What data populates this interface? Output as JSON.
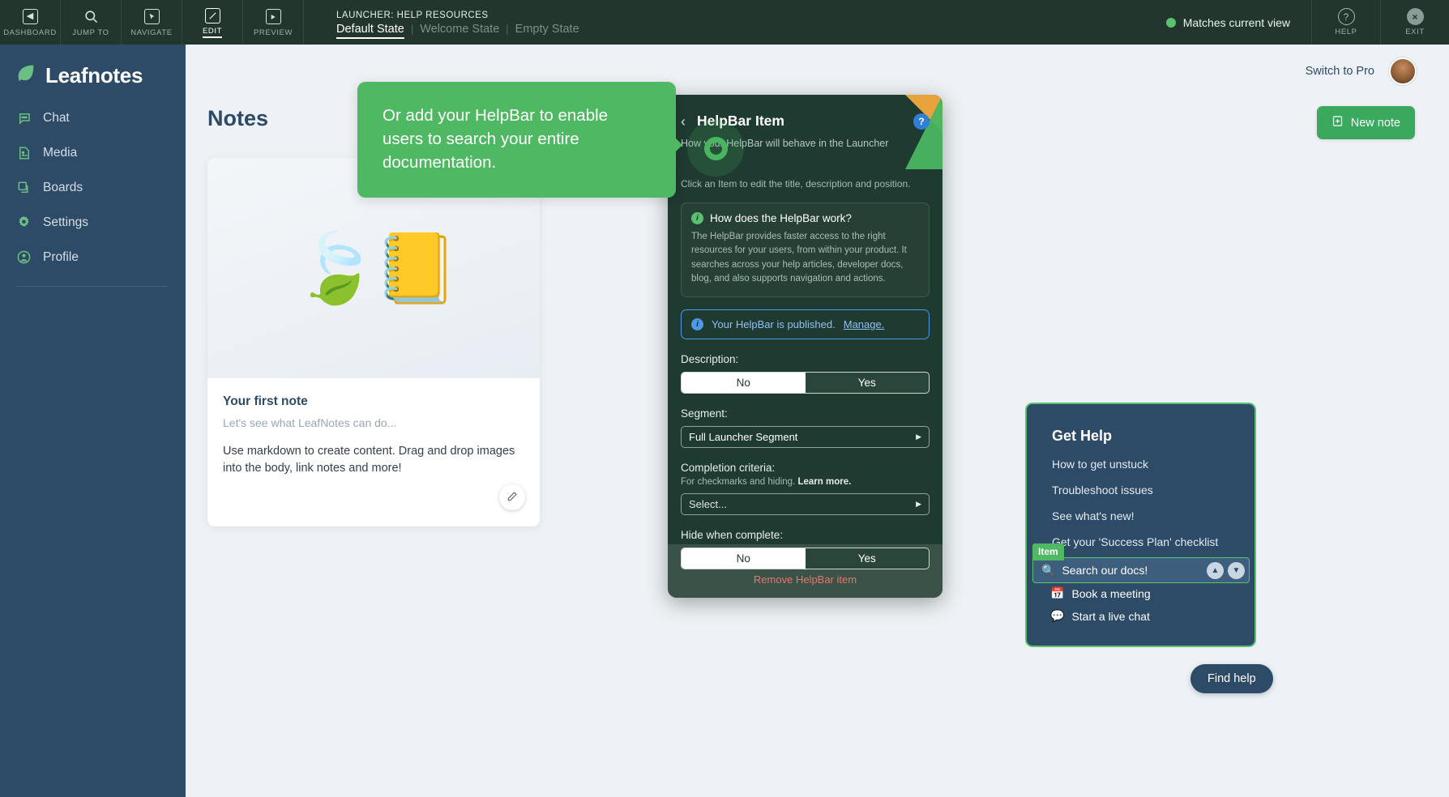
{
  "builder_bar": {
    "tools": [
      {
        "label": "DASHBOARD",
        "icon": "dashboard-icon",
        "glyph": "◀",
        "active": false
      },
      {
        "label": "JUMP TO",
        "icon": "search-icon",
        "glyph": "⚲",
        "active": false
      },
      {
        "label": "NAVIGATE",
        "icon": "cursor-icon",
        "glyph": "➤",
        "active": false
      },
      {
        "label": "EDIT",
        "icon": "pencil-icon",
        "glyph": "╱",
        "active": true
      },
      {
        "label": "PREVIEW",
        "icon": "play-icon",
        "glyph": "▶",
        "active": false
      }
    ],
    "title": "LAUNCHER: HELP RESOURCES",
    "states": [
      {
        "label": "Default State",
        "selected": true
      },
      {
        "label": "Welcome State",
        "selected": false
      },
      {
        "label": "Empty State",
        "selected": false
      }
    ],
    "state_separator": "|",
    "match_status": "Matches current view",
    "match_dot_color": "#5ac26e",
    "help_label": "HELP",
    "exit_label": "EXIT",
    "help_glyph": "?",
    "exit_glyph": "×"
  },
  "sidebar": {
    "brand": "Leafnotes",
    "brand_icon": "leaf-icon",
    "items": [
      {
        "label": "Chat",
        "icon": "chat-icon"
      },
      {
        "label": "Media",
        "icon": "media-image-icon"
      },
      {
        "label": "Boards",
        "icon": "boards-copy-icon"
      },
      {
        "label": "Settings",
        "icon": "gear-icon"
      },
      {
        "label": "Profile",
        "icon": "user-circle-icon"
      }
    ]
  },
  "main": {
    "switch_to_pro": "Switch to Pro",
    "page_title": "Notes",
    "new_note_label": "New note",
    "new_note_icon": "note-plus-icon",
    "note_card": {
      "hero_emoji": "🍃📒",
      "title": "Your first note",
      "subtitle": "Let's see what LeafNotes can do...",
      "body": "Use markdown to create content. Drag and drop images into the body, link notes and more!",
      "edit_icon": "pencil-icon"
    }
  },
  "tooltip": {
    "text": "Or add your HelpBar to enable users to search your entire documentation.",
    "color": "#4fb862"
  },
  "helpbar_panel": {
    "back_icon": "chevron-left-icon",
    "title": "HelpBar Item",
    "help_badge": "?",
    "subtitle": "How your HelpBar will behave in the Launcher",
    "hint": "Click an Item to edit the title, description and position.",
    "info_box": {
      "icon": "info-icon",
      "title": "How does the HelpBar work?",
      "text": "The HelpBar provides faster access to the right resources for your users, from within your product. It searches across your help articles, developer docs, blog, and also supports navigation and actions."
    },
    "published_banner": {
      "icon": "info-icon",
      "text": "Your HelpBar is published.",
      "link": "Manage."
    },
    "fields": [
      {
        "label": "Description:",
        "type": "toggle",
        "options": [
          "No",
          "Yes"
        ],
        "selected": "Yes"
      },
      {
        "label": "Segment:",
        "type": "select",
        "value": "Full Launcher Segment",
        "caret": "▶"
      },
      {
        "label": "Completion criteria:",
        "sublabel_text": "For checkmarks and hiding. ",
        "sublabel_link": "Learn more.",
        "type": "select",
        "value": "Select...",
        "caret": "▶"
      },
      {
        "label": "Hide when complete:",
        "type": "toggle",
        "options": [
          "No",
          "Yes"
        ],
        "selected": "Yes"
      }
    ],
    "remove_label": "Remove HelpBar item",
    "remove_icon": "trash-icon",
    "remove_glyph": "🗑"
  },
  "get_help_widget": {
    "title": "Get Help",
    "links": [
      "How to get unstuck",
      "Troubleshoot issues",
      "See what's new!",
      "Get your 'Success Plan' checklist"
    ],
    "item_tag": "Item",
    "search_row": {
      "icon": "magnifier-icon",
      "glyph": "🔍",
      "label": "Search our docs!",
      "up_arrow": "▲",
      "down_arrow": "▼"
    },
    "extra_items": [
      {
        "glyph": "📅",
        "label": "Book a meeting",
        "icon": "calendar-icon"
      },
      {
        "glyph": "💬",
        "label": "Start a live chat",
        "icon": "chat-bubble-icon"
      }
    ],
    "find_help_label": "Find help"
  }
}
